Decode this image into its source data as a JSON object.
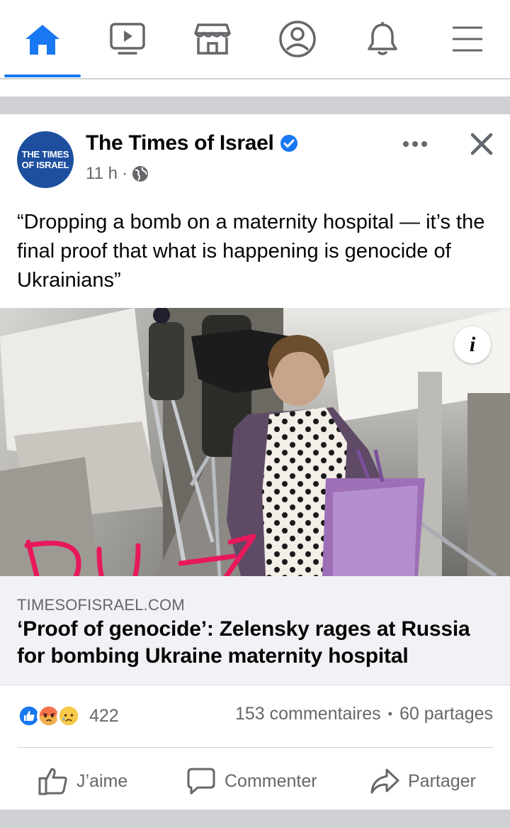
{
  "nav": {
    "items": [
      {
        "name": "home-icon",
        "active": true
      },
      {
        "name": "watch-icon"
      },
      {
        "name": "marketplace-icon"
      },
      {
        "name": "profile-icon"
      },
      {
        "name": "notifications-icon"
      },
      {
        "name": "menu-icon"
      }
    ],
    "accent": "#1877f2"
  },
  "post": {
    "page_name": "The Times of Israel",
    "avatar_line1": "THE TIMES",
    "avatar_line2": "OF ISRAEL",
    "time": "11 h",
    "privacy_icon": "globe-icon",
    "text": "“Dropping a bomb on a maternity hospital — it’s the final proof that what is happening is genocide of Ukrainians”",
    "handwritten_annotation": "DU→",
    "annotation_color": "#e8185c"
  },
  "link": {
    "domain": "TIMESOFISRAEL.COM",
    "title": "‘Proof of genocide’: Zelensky rages at Russia for bombing Ukraine maternity hospital"
  },
  "reactions": {
    "count": "422",
    "icons": [
      "like-icon",
      "angry-icon",
      "sad-icon"
    ],
    "comments": "153 commentaires",
    "separator": "•",
    "shares": "60 partages"
  },
  "actions": {
    "like": "J’aime",
    "comment": "Commenter",
    "share": "Partager"
  },
  "info_label": "i"
}
